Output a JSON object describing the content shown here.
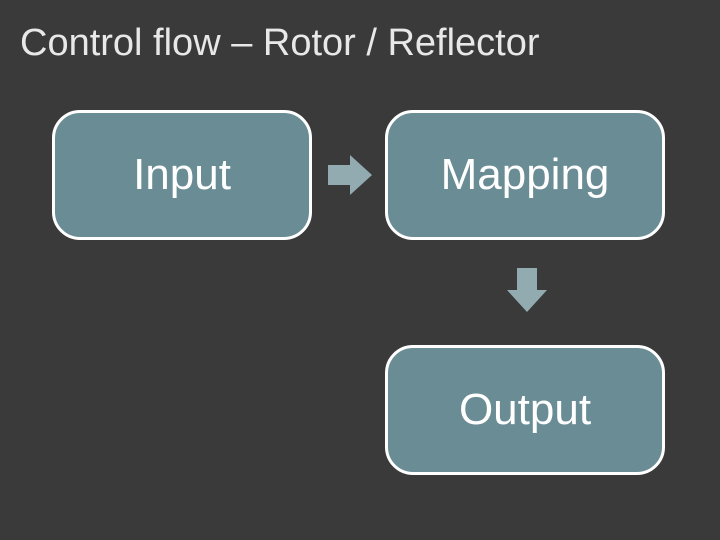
{
  "title": "Control flow – Rotor / Reflector",
  "boxes": {
    "input": "Input",
    "mapping": "Mapping",
    "output": "Output"
  }
}
